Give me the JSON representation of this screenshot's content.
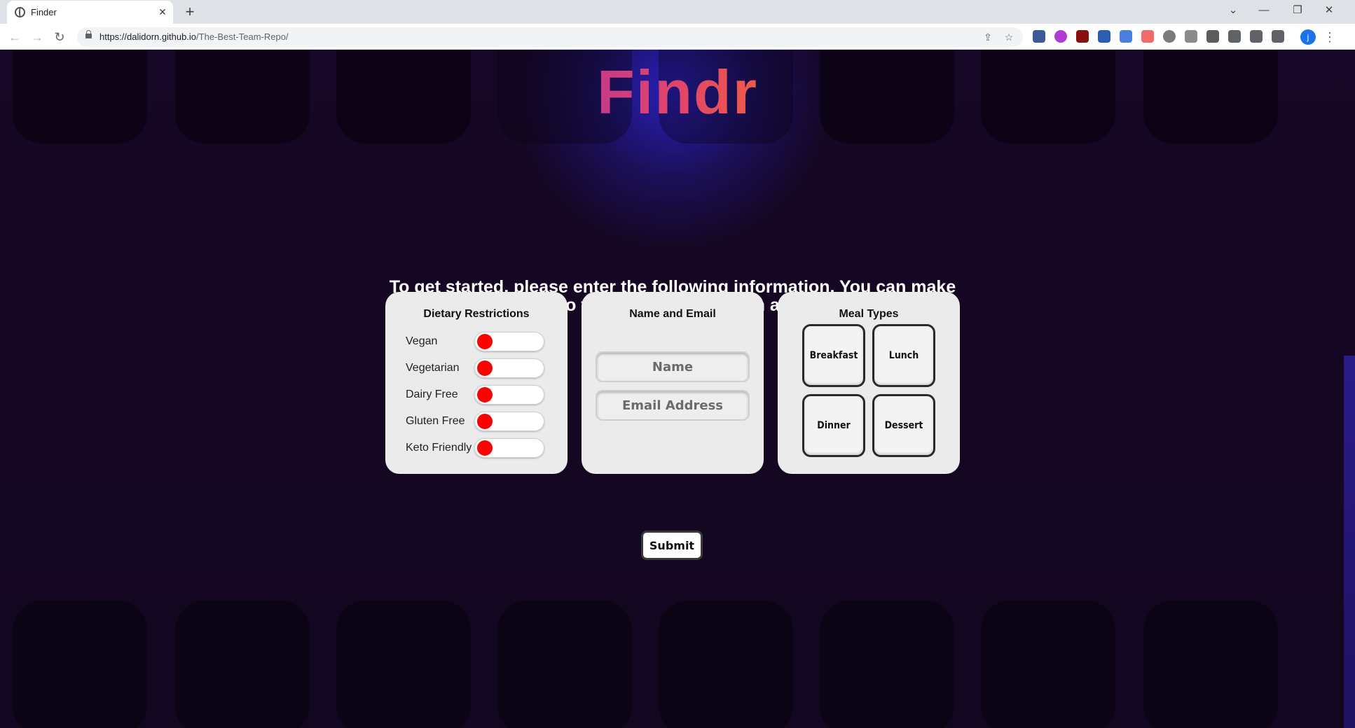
{
  "browser": {
    "tab_title": "Finder",
    "tab_close": "✕",
    "new_tab": "+",
    "url_host": "https://dalidorn.github.io",
    "url_path": "/The-Best-Team-Repo/",
    "profile_initial": "j",
    "window_controls": [
      "⌄",
      "—",
      "❐",
      "✕"
    ]
  },
  "page": {
    "title": "Findr",
    "intro": "To get started, please enter the following information. You can make changes to these choices later on at anytime."
  },
  "dietary": {
    "title": "Dietary Restrictions",
    "items": [
      {
        "label": "Vegan",
        "enabled": false
      },
      {
        "label": "Vegetarian",
        "enabled": false
      },
      {
        "label": "Dairy Free",
        "enabled": false
      },
      {
        "label": "Gluten Free",
        "enabled": false
      },
      {
        "label": "Keto Friendly",
        "enabled": false
      }
    ]
  },
  "contact": {
    "title": "Name and Email",
    "name_placeholder": "Name",
    "email_placeholder": "Email Address"
  },
  "meals": {
    "title": "Meal Types",
    "options": [
      "Breakfast",
      "Lunch",
      "Dinner",
      "Dessert"
    ]
  },
  "submit_label": "Submit",
  "colors": {
    "toggle_off": "#ff0000",
    "background": "#150722",
    "title_gradient": [
      "#c73a8a",
      "#f05a48"
    ]
  }
}
